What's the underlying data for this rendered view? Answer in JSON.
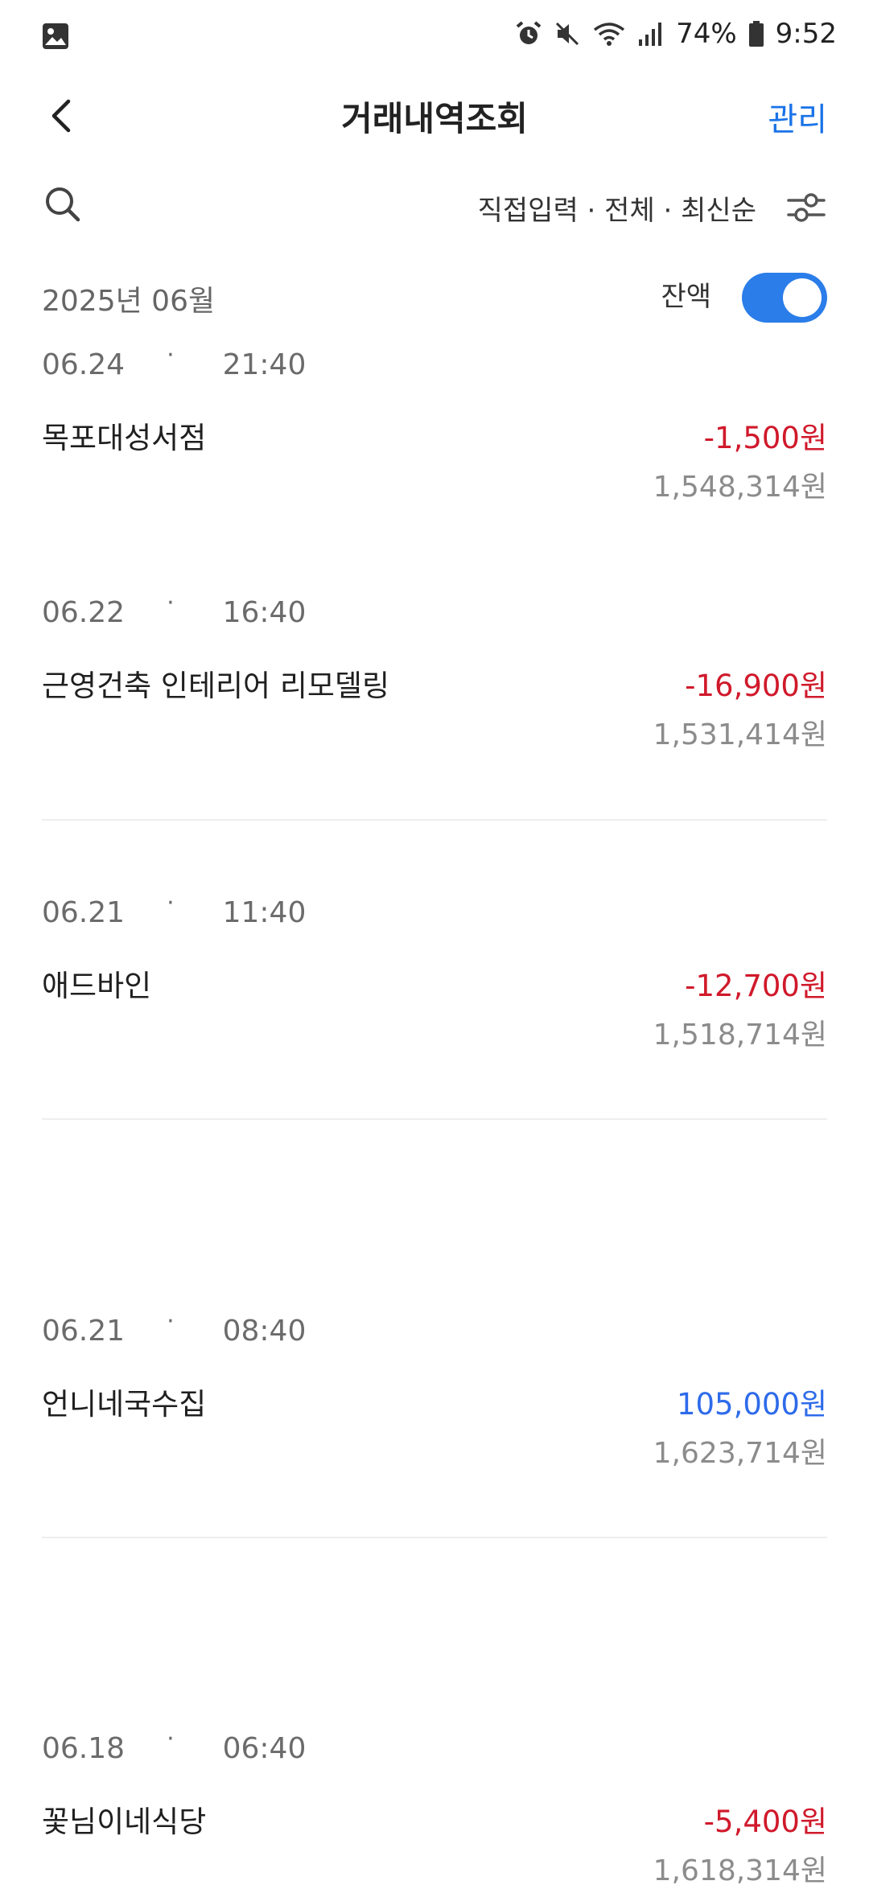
{
  "status_bar": {
    "battery": "74%",
    "time": "9:52",
    "icons": [
      "gallery-icon",
      "alarm-icon",
      "mute-icon",
      "wifi-icon",
      "signal-icon",
      "battery-icon"
    ]
  },
  "header": {
    "title": "거래내역조회",
    "manage_label": "관리",
    "accent_color": "#1a73e8"
  },
  "filter": {
    "summary": "직접입력 · 전체 · 최신순"
  },
  "month_section": {
    "month": "2025년 06월",
    "balance_label": "잔액",
    "balance_toggle_on": true
  },
  "transactions": [
    {
      "date": "06.24",
      "time": "21:40",
      "name": "목포대성서점",
      "amount": "-1,500원",
      "type": "withdrawal",
      "balance": "1,548,314원"
    },
    {
      "date": "06.22",
      "time": "16:40",
      "name": "근영건축 인테리어 리모델링",
      "amount": "-16,900원",
      "type": "withdrawal",
      "balance": "1,531,414원"
    },
    {
      "date": "06.21",
      "time": "11:40",
      "name": "애드바인",
      "amount": "-12,700원",
      "type": "withdrawal",
      "balance": "1,518,714원"
    },
    {
      "date": "06.21",
      "time": "08:40",
      "name": "언니네국수집",
      "amount": "105,000원",
      "type": "deposit",
      "balance": "1,623,714원"
    },
    {
      "date": "06.18",
      "time": "06:40",
      "name": "꽃님이네식당",
      "amount": "-5,400원",
      "type": "withdrawal",
      "balance": "1,618,314원"
    }
  ],
  "colors": {
    "withdrawal": "#d0192b",
    "deposit": "#2e6bea",
    "toggle": "#2b7de9"
  }
}
